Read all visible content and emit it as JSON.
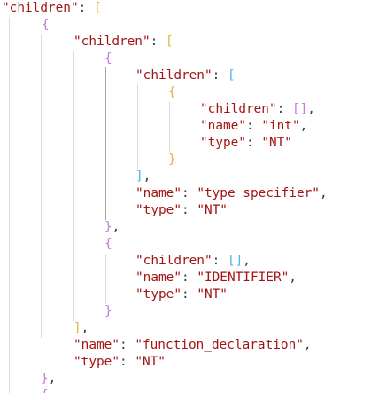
{
  "lines": [
    {
      "tokens": [
        {
          "t": "\"children\"",
          "c": "key"
        },
        {
          "t": ": ",
          "c": "p"
        },
        {
          "t": "[",
          "c": "b-gold"
        }
      ]
    },
    {
      "tokens": [
        {
          "t": "{",
          "c": "b-purple"
        }
      ]
    },
    {
      "tokens": [
        {
          "t": "\"children\"",
          "c": "key"
        },
        {
          "t": ": ",
          "c": "p"
        },
        {
          "t": "[",
          "c": "b-gold"
        }
      ]
    },
    {
      "tokens": [
        {
          "t": "{",
          "c": "b-purple"
        }
      ]
    },
    {
      "tokens": [
        {
          "t": "\"children\"",
          "c": "key"
        },
        {
          "t": ": ",
          "c": "p"
        },
        {
          "t": "[",
          "c": "b-blue"
        }
      ]
    },
    {
      "tokens": [
        {
          "t": "{",
          "c": "b-gold"
        }
      ]
    },
    {
      "tokens": [
        {
          "t": "\"children\"",
          "c": "key"
        },
        {
          "t": ": ",
          "c": "p"
        },
        {
          "t": "[]",
          "c": "b-purple"
        },
        {
          "t": ",",
          "c": "p"
        }
      ]
    },
    {
      "tokens": [
        {
          "t": "\"name\"",
          "c": "key"
        },
        {
          "t": ": ",
          "c": "p"
        },
        {
          "t": "\"int\"",
          "c": "str"
        },
        {
          "t": ",",
          "c": "p"
        }
      ]
    },
    {
      "tokens": [
        {
          "t": "\"type\"",
          "c": "key"
        },
        {
          "t": ": ",
          "c": "p"
        },
        {
          "t": "\"NT\"",
          "c": "str"
        }
      ]
    },
    {
      "tokens": [
        {
          "t": "}",
          "c": "b-gold"
        }
      ]
    },
    {
      "tokens": [
        {
          "t": "]",
          "c": "b-blue"
        },
        {
          "t": ",",
          "c": "p"
        }
      ]
    },
    {
      "tokens": [
        {
          "t": "\"name\"",
          "c": "key"
        },
        {
          "t": ": ",
          "c": "p"
        },
        {
          "t": "\"type_specifier\"",
          "c": "str"
        },
        {
          "t": ",",
          "c": "p"
        }
      ]
    },
    {
      "tokens": [
        {
          "t": "\"type\"",
          "c": "key"
        },
        {
          "t": ": ",
          "c": "p"
        },
        {
          "t": "\"NT\"",
          "c": "str"
        }
      ]
    },
    {
      "tokens": [
        {
          "t": "}",
          "c": "b-purple"
        },
        {
          "t": ",",
          "c": "p"
        }
      ]
    },
    {
      "tokens": [
        {
          "t": "{",
          "c": "b-purple"
        }
      ]
    },
    {
      "tokens": [
        {
          "t": "\"children\"",
          "c": "key"
        },
        {
          "t": ": ",
          "c": "p"
        },
        {
          "t": "[]",
          "c": "b-blue"
        },
        {
          "t": ",",
          "c": "p"
        }
      ]
    },
    {
      "tokens": [
        {
          "t": "\"name\"",
          "c": "key"
        },
        {
          "t": ": ",
          "c": "p"
        },
        {
          "t": "\"IDENTIFIER\"",
          "c": "str"
        },
        {
          "t": ",",
          "c": "p"
        }
      ]
    },
    {
      "tokens": [
        {
          "t": "\"type\"",
          "c": "key"
        },
        {
          "t": ": ",
          "c": "p"
        },
        {
          "t": "\"NT\"",
          "c": "str"
        }
      ]
    },
    {
      "tokens": [
        {
          "t": "}",
          "c": "b-purple"
        }
      ]
    },
    {
      "tokens": [
        {
          "t": "]",
          "c": "b-gold"
        },
        {
          "t": ",",
          "c": "p"
        }
      ]
    },
    {
      "tokens": [
        {
          "t": "\"name\"",
          "c": "key"
        },
        {
          "t": ": ",
          "c": "p"
        },
        {
          "t": "\"function_declaration\"",
          "c": "str"
        },
        {
          "t": ",",
          "c": "p"
        }
      ]
    },
    {
      "tokens": [
        {
          "t": "\"type\"",
          "c": "key"
        },
        {
          "t": ": ",
          "c": "p"
        },
        {
          "t": "\"NT\"",
          "c": "str"
        }
      ]
    },
    {
      "tokens": [
        {
          "t": "}",
          "c": "b-purple"
        },
        {
          "t": ",",
          "c": "p"
        }
      ]
    },
    {
      "tokens": [
        {
          "t": "{",
          "c": "b-purple"
        }
      ]
    }
  ],
  "theme": {
    "background": "#ffffff",
    "json_key_color": "#a31515",
    "json_string_color": "#a31515",
    "punctuation_color": "#3b3b3b",
    "bracket_gold": "#e3b341",
    "bracket_purple": "#c678dd",
    "bracket_blue": "#4fb3ee",
    "indent_guide_color": "#dcdcdc"
  }
}
